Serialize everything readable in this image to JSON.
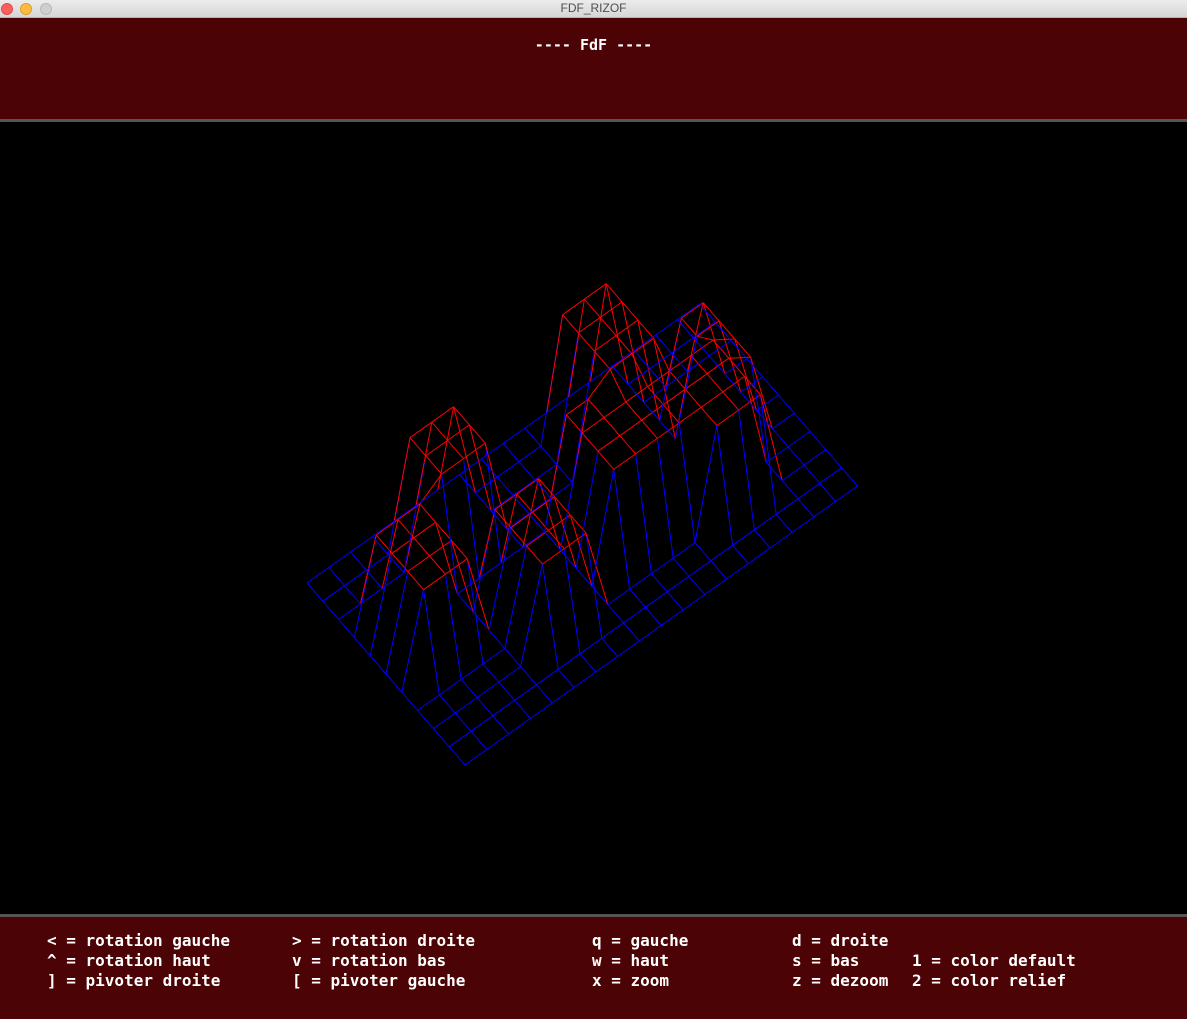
{
  "window": {
    "title": "FDF_RIZOF"
  },
  "header": {
    "title": "---- FdF ----"
  },
  "render": {
    "description_colors": {
      "background": "#000000",
      "low_color": "#0000ff",
      "high_color": "#ff0000",
      "panel_color": "#4c0305"
    },
    "map_rows": 19,
    "map_cols": 11
  },
  "controls": {
    "col1": [
      "< = rotation gauche",
      "^ = rotation haut",
      "] = pivoter droite"
    ],
    "col2": [
      "> = rotation droite",
      "v = rotation bas",
      "[ = pivoter gauche"
    ],
    "col3": [
      "q = gauche",
      "w = haut",
      "x = zoom"
    ],
    "col4": [
      "d = droite",
      "s = bas",
      "z = dezoom"
    ],
    "col5": [
      "1 = color default",
      "2 = color relief"
    ]
  }
}
